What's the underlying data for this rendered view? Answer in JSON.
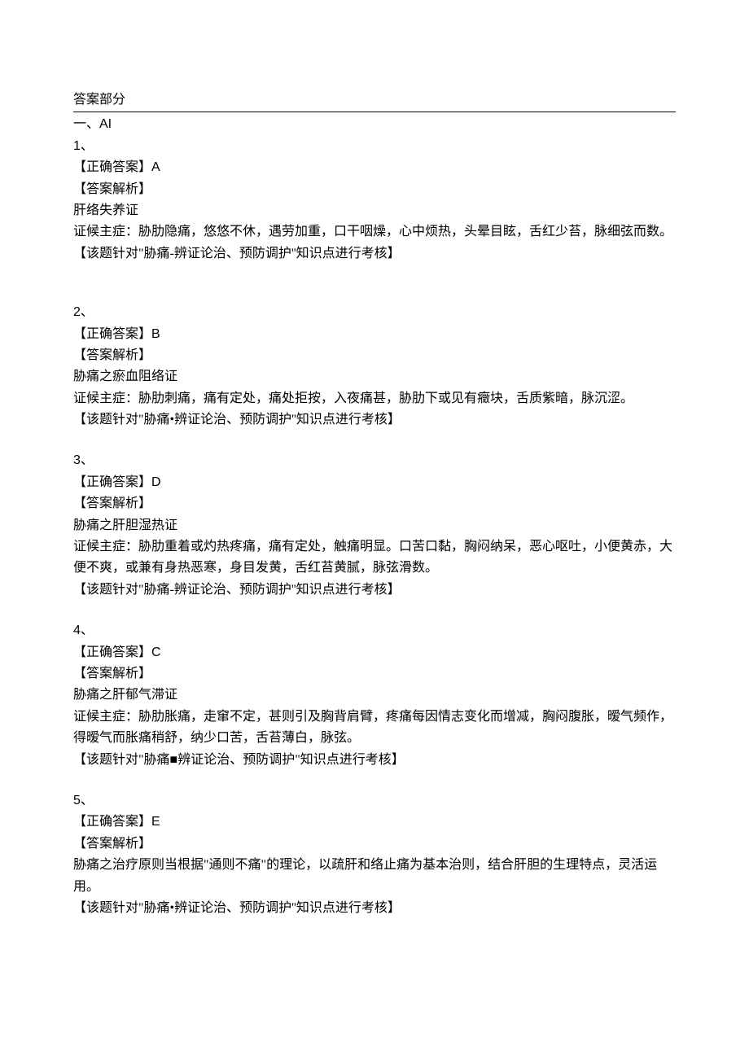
{
  "header": {
    "answers_title": "答案部分",
    "section_label": "一、AI"
  },
  "questions": [
    {
      "no": "1、",
      "correct_label": "【正确答案】",
      "correct_value": "A",
      "analysis_label": "【答案解析】",
      "syndrome": "肝络失养证",
      "symptoms": "证候主症：胁肋隐痛，悠悠不休，遇劳加重，口干咽燥，心中烦热，头晕目眩，舌红少苔，脉细弦而数。",
      "note": "【该题针对\"胁痛-辨证论治、预防调护''知识点进行考核】"
    },
    {
      "no": "2、",
      "correct_label": "【正确答案】",
      "correct_value": "B",
      "analysis_label": "【答案解析】",
      "syndrome": "胁痛之瘀血阻络证",
      "symptoms": "证候主症：胁肋刺痛，痛有定处，痛处拒按，入夜痛甚，胁肋下或见有癥块，舌质紫暗，脉沉涩。",
      "note": "【该题针对\"胁痛•辨证论治、预防调护''知识点进行考核】"
    },
    {
      "no": "3、",
      "correct_label": "【正确答案】",
      "correct_value": "D",
      "analysis_label": "【答案解析】",
      "syndrome": "胁痛之肝胆湿热证",
      "symptoms": "证候主症：胁肋重着或灼热疼痛，痛有定处，触痛明显。口苦口黏，胸闷纳呆，恶心呕吐，小便黄赤，大便不爽，或兼有身热恶寒，身目发黄，舌红苔黄腻，脉弦滑数。",
      "note": "【该题针对\"胁痛-辨证论治、预防调护''知识点进行考核】"
    },
    {
      "no": "4、",
      "correct_label": "【正确答案】",
      "correct_value": "C",
      "analysis_label": "【答案解析】",
      "syndrome": "胁痛之肝郁气滞证",
      "symptoms": "证候主症：胁肋胀痛，走窜不定，甚则引及胸背肩臂，疼痛每因情志变化而增减，胸闷腹胀，暧气频作，得暧气而胀痛稍舒，纳少口苦，舌苔薄白，脉弦。",
      "note": "【该题针对\"胁痛■辨证论治、预防调护\"知识点进行考核】"
    },
    {
      "no": "5、",
      "correct_label": "【正确答案】",
      "correct_value": "E",
      "analysis_label": "【答案解析】",
      "syndrome": "",
      "symptoms": "胁痛之治疗原则当根据\"通则不痛\"的理论，以疏肝和络止痛为基本治则，结合肝胆的生理特点，灵活运用。",
      "note": "【该题针对\"胁痛•辨证论治、预防调护''知识点进行考核】"
    }
  ]
}
